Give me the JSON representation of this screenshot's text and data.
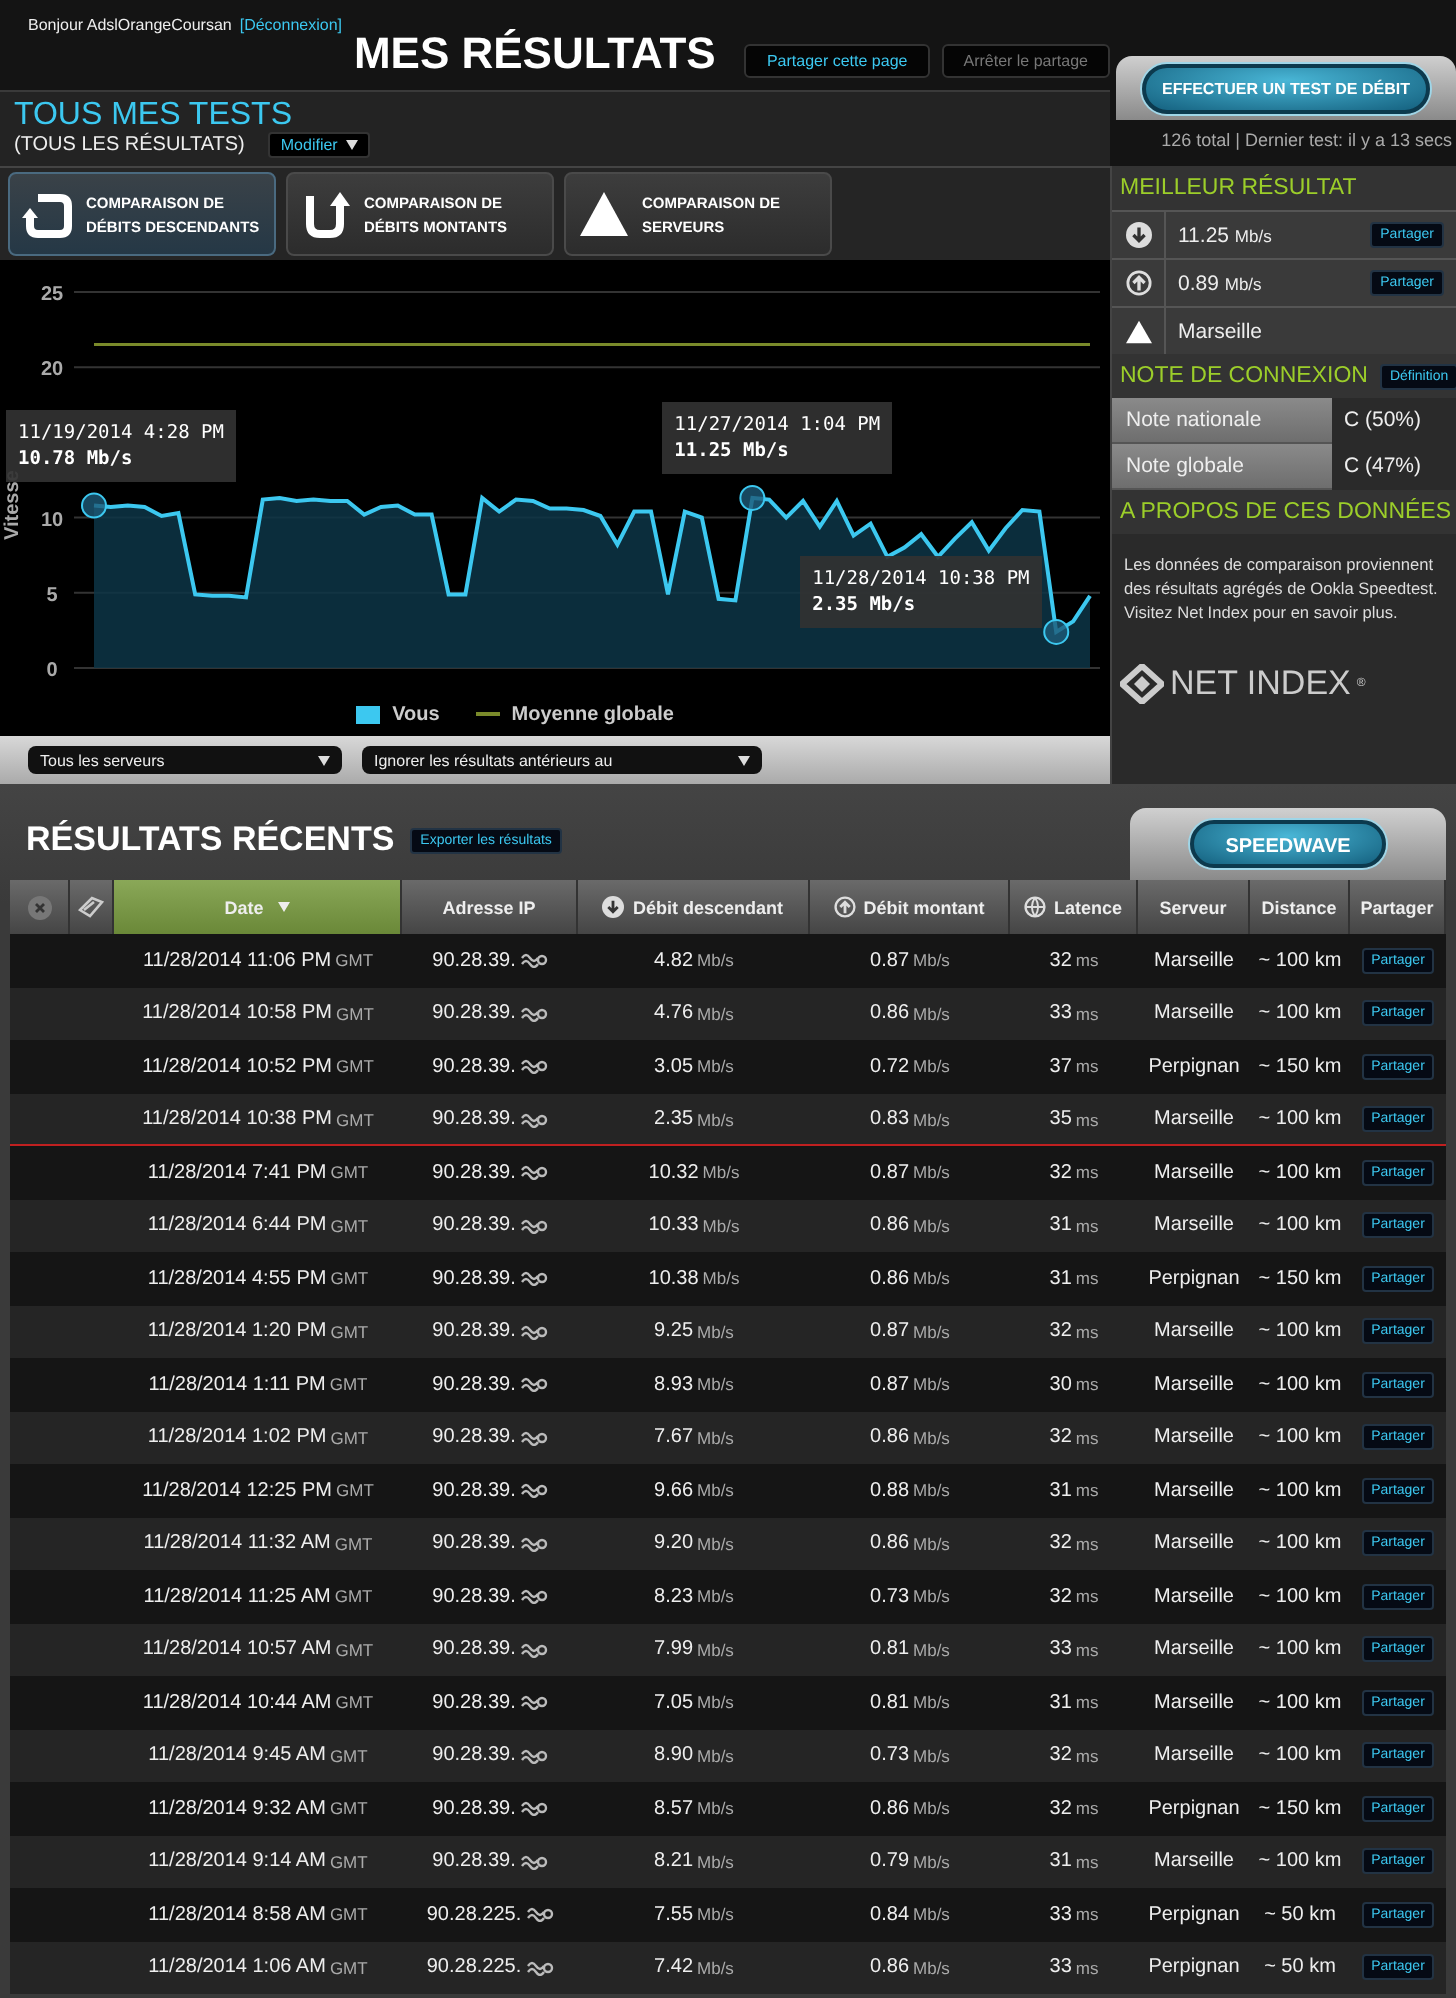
{
  "header": {
    "greeting": "Bonjour AdslOrangeCoursan",
    "logout": "[Déconnexion]",
    "title": "MES RÉSULTATS",
    "share_buttons": [
      {
        "label": "Partager cette page",
        "disabled": false
      },
      {
        "label": "Arrêter le partage",
        "disabled": true
      }
    ]
  },
  "test_button": "EFFECTUER UN TEST DE DÉBIT",
  "summary": "126 total | Dernier test: il y a 13 secs",
  "tests": {
    "title": "TOUS MES TESTS",
    "subtitle": "(TOUS LES RÉSULTATS)",
    "modify": "Modifier"
  },
  "compare_buttons": [
    {
      "kind": "download",
      "lines": [
        "COMPARAISON DE",
        "DÉBITS DESCENDANTS"
      ],
      "selected": true
    },
    {
      "kind": "upload",
      "lines": [
        "COMPARAISON DE",
        "DÉBITS MONTANTS"
      ],
      "selected": false
    },
    {
      "kind": "server",
      "lines": [
        "COMPARAISON DE",
        "SERVEURS"
      ],
      "selected": false
    }
  ],
  "chart_data": {
    "type": "line",
    "ylabel": "Vitesse",
    "ylim": [
      0,
      25
    ],
    "yticks": [
      0,
      5,
      10,
      20,
      25
    ],
    "grid": true,
    "legend": "bottom",
    "series": [
      {
        "name": "Vous",
        "color": "#3cc8f0",
        "values": [
          10.8,
          10.7,
          10.8,
          10.7,
          10.1,
          10.3,
          4.9,
          4.8,
          4.8,
          4.7,
          11.2,
          11.3,
          11.1,
          11.2,
          11.1,
          11.1,
          10.2,
          10.7,
          10.8,
          10.2,
          10.2,
          4.9,
          4.9,
          11.3,
          10.4,
          11.2,
          11.1,
          10.6,
          10.6,
          10.5,
          10.1,
          8.2,
          10.4,
          10.4,
          4.9,
          10.4,
          10.0,
          4.6,
          4.5,
          11.3,
          11.2,
          10.0,
          11.1,
          9.4,
          11.1,
          8.8,
          9.6,
          7.4,
          8.0,
          8.9,
          7.4,
          8.6,
          9.7,
          7.8,
          9.3,
          10.5,
          10.4,
          2.4,
          3.1,
          4.8
        ]
      },
      {
        "name": "Moyenne globale",
        "color": "#7a8a2a",
        "values": [
          21.5,
          21.5,
          21.5,
          21.5,
          21.5,
          21.5,
          21.5,
          21.5,
          21.5,
          21.5,
          21.5,
          21.5,
          21.5,
          21.5,
          21.5,
          21.5,
          21.5,
          21.5,
          21.5,
          21.5,
          21.5,
          21.5,
          21.5,
          21.5,
          21.5,
          21.5,
          21.5,
          21.5,
          21.5,
          21.5,
          21.5,
          21.5,
          21.5,
          21.5,
          21.5,
          21.5,
          21.5,
          21.5,
          21.5,
          21.5,
          21.5,
          21.5,
          21.5,
          21.5,
          21.5,
          21.5,
          21.5,
          21.5,
          21.5,
          21.5,
          21.5,
          21.5,
          21.5,
          21.5,
          21.5,
          21.5,
          21.5,
          21.5,
          21.5,
          21.5
        ]
      }
    ],
    "annotations": [
      "11/19/2014 4:28 PM\n10.78 Mb/s",
      "11/27/2014 1:04 PM\n11.25 Mb/s",
      "11/28/2014 10:38 PM\n2.35 Mb/s"
    ]
  },
  "filters": [
    "Tous les serveurs",
    "Ignorer les résultats antérieurs au"
  ],
  "best": {
    "title": "MEILLEUR RÉSULTAT",
    "items": [
      {
        "kind": "download",
        "value": "11.25",
        "unit": "Mb/s",
        "share": "Partager"
      },
      {
        "kind": "upload",
        "value": "0.89",
        "unit": "Mb/s",
        "share": "Partager"
      },
      {
        "kind": "server",
        "value": "Marseille"
      }
    ]
  },
  "grade": {
    "title": "NOTE DE CONNEXION",
    "definition": "Définition",
    "rows": [
      {
        "label": "Note nationale",
        "value": "C (50%)"
      },
      {
        "label": "Note globale",
        "value": "C (47%)"
      }
    ]
  },
  "about": {
    "title": "A PROPOS DE CES DONNÉES",
    "text": "Les données de comparaison proviennent des résultats agrégés de Ookla Speedtest. Visitez Net Index pour en savoir plus.",
    "logo": "NET INDEX",
    "logo_mark": "®"
  },
  "recent": {
    "title": "RÉSULTATS RÉCENTS",
    "export": "Exporter les résultats",
    "speedwave": "SPEEDWAVE"
  },
  "table": {
    "columns": [
      {
        "kind": "clear",
        "selected": false
      },
      {
        "kind": "tag",
        "selected": false
      },
      {
        "kind": "text",
        "label": "Date",
        "selected": true
      },
      {
        "kind": "text",
        "label": "Adresse IP",
        "selected": false
      },
      {
        "kind": "download",
        "label": "Débit descendant",
        "selected": false
      },
      {
        "kind": "upload",
        "label": "Débit montant",
        "selected": false
      },
      {
        "kind": "latency",
        "label": "Latence",
        "selected": false
      },
      {
        "kind": "text",
        "label": "Serveur",
        "selected": false
      },
      {
        "kind": "text",
        "label": "Distance",
        "selected": false
      },
      {
        "kind": "text",
        "label": "Partager",
        "selected": false
      }
    ],
    "rows": [
      {
        "date": "11/28/2014 11:06 PM",
        "tz": "GMT",
        "ip": "90.28.39.",
        "down": "4.82",
        "down_unit": "Mb/s",
        "up": "0.87",
        "up_unit": "Mb/s",
        "latency": "32",
        "latency_unit": "ms",
        "server": "Marseille",
        "distance": "~ 100 km",
        "share": "Partager",
        "highlighted": false
      },
      {
        "date": "11/28/2014 10:58 PM",
        "tz": "GMT",
        "ip": "90.28.39.",
        "down": "4.76",
        "down_unit": "Mb/s",
        "up": "0.86",
        "up_unit": "Mb/s",
        "latency": "33",
        "latency_unit": "ms",
        "server": "Marseille",
        "distance": "~ 100 km",
        "share": "Partager",
        "highlighted": false
      },
      {
        "date": "11/28/2014 10:52 PM",
        "tz": "GMT",
        "ip": "90.28.39.",
        "down": "3.05",
        "down_unit": "Mb/s",
        "up": "0.72",
        "up_unit": "Mb/s",
        "latency": "37",
        "latency_unit": "ms",
        "server": "Perpignan",
        "distance": "~ 150 km",
        "share": "Partager",
        "highlighted": false
      },
      {
        "date": "11/28/2014 10:38 PM",
        "tz": "GMT",
        "ip": "90.28.39.",
        "down": "2.35",
        "down_unit": "Mb/s",
        "up": "0.83",
        "up_unit": "Mb/s",
        "latency": "35",
        "latency_unit": "ms",
        "server": "Marseille",
        "distance": "~ 100 km",
        "share": "Partager",
        "highlighted": true
      },
      {
        "date": "11/28/2014 7:41 PM",
        "tz": "GMT",
        "ip": "90.28.39.",
        "down": "10.32",
        "down_unit": "Mb/s",
        "up": "0.87",
        "up_unit": "Mb/s",
        "latency": "32",
        "latency_unit": "ms",
        "server": "Marseille",
        "distance": "~ 100 km",
        "share": "Partager",
        "highlighted": false
      },
      {
        "date": "11/28/2014 6:44 PM",
        "tz": "GMT",
        "ip": "90.28.39.",
        "down": "10.33",
        "down_unit": "Mb/s",
        "up": "0.86",
        "up_unit": "Mb/s",
        "latency": "31",
        "latency_unit": "ms",
        "server": "Marseille",
        "distance": "~ 100 km",
        "share": "Partager",
        "highlighted": false
      },
      {
        "date": "11/28/2014 4:55 PM",
        "tz": "GMT",
        "ip": "90.28.39.",
        "down": "10.38",
        "down_unit": "Mb/s",
        "up": "0.86",
        "up_unit": "Mb/s",
        "latency": "31",
        "latency_unit": "ms",
        "server": "Perpignan",
        "distance": "~ 150 km",
        "share": "Partager",
        "highlighted": false
      },
      {
        "date": "11/28/2014 1:20 PM",
        "tz": "GMT",
        "ip": "90.28.39.",
        "down": "9.25",
        "down_unit": "Mb/s",
        "up": "0.87",
        "up_unit": "Mb/s",
        "latency": "32",
        "latency_unit": "ms",
        "server": "Marseille",
        "distance": "~ 100 km",
        "share": "Partager",
        "highlighted": false
      },
      {
        "date": "11/28/2014 1:11 PM",
        "tz": "GMT",
        "ip": "90.28.39.",
        "down": "8.93",
        "down_unit": "Mb/s",
        "up": "0.87",
        "up_unit": "Mb/s",
        "latency": "30",
        "latency_unit": "ms",
        "server": "Marseille",
        "distance": "~ 100 km",
        "share": "Partager",
        "highlighted": false
      },
      {
        "date": "11/28/2014 1:02 PM",
        "tz": "GMT",
        "ip": "90.28.39.",
        "down": "7.67",
        "down_unit": "Mb/s",
        "up": "0.86",
        "up_unit": "Mb/s",
        "latency": "32",
        "latency_unit": "ms",
        "server": "Marseille",
        "distance": "~ 100 km",
        "share": "Partager",
        "highlighted": false
      },
      {
        "date": "11/28/2014 12:25 PM",
        "tz": "GMT",
        "ip": "90.28.39.",
        "down": "9.66",
        "down_unit": "Mb/s",
        "up": "0.88",
        "up_unit": "Mb/s",
        "latency": "31",
        "latency_unit": "ms",
        "server": "Marseille",
        "distance": "~ 100 km",
        "share": "Partager",
        "highlighted": false
      },
      {
        "date": "11/28/2014 11:32 AM",
        "tz": "GMT",
        "ip": "90.28.39.",
        "down": "9.20",
        "down_unit": "Mb/s",
        "up": "0.86",
        "up_unit": "Mb/s",
        "latency": "32",
        "latency_unit": "ms",
        "server": "Marseille",
        "distance": "~ 100 km",
        "share": "Partager",
        "highlighted": false
      },
      {
        "date": "11/28/2014 11:25 AM",
        "tz": "GMT",
        "ip": "90.28.39.",
        "down": "8.23",
        "down_unit": "Mb/s",
        "up": "0.73",
        "up_unit": "Mb/s",
        "latency": "32",
        "latency_unit": "ms",
        "server": "Marseille",
        "distance": "~ 100 km",
        "share": "Partager",
        "highlighted": false
      },
      {
        "date": "11/28/2014 10:57 AM",
        "tz": "GMT",
        "ip": "90.28.39.",
        "down": "7.99",
        "down_unit": "Mb/s",
        "up": "0.81",
        "up_unit": "Mb/s",
        "latency": "33",
        "latency_unit": "ms",
        "server": "Marseille",
        "distance": "~ 100 km",
        "share": "Partager",
        "highlighted": false
      },
      {
        "date": "11/28/2014 10:44 AM",
        "tz": "GMT",
        "ip": "90.28.39.",
        "down": "7.05",
        "down_unit": "Mb/s",
        "up": "0.81",
        "up_unit": "Mb/s",
        "latency": "31",
        "latency_unit": "ms",
        "server": "Marseille",
        "distance": "~ 100 km",
        "share": "Partager",
        "highlighted": false
      },
      {
        "date": "11/28/2014 9:45 AM",
        "tz": "GMT",
        "ip": "90.28.39.",
        "down": "8.90",
        "down_unit": "Mb/s",
        "up": "0.73",
        "up_unit": "Mb/s",
        "latency": "32",
        "latency_unit": "ms",
        "server": "Marseille",
        "distance": "~ 100 km",
        "share": "Partager",
        "highlighted": false
      },
      {
        "date": "11/28/2014 9:32 AM",
        "tz": "GMT",
        "ip": "90.28.39.",
        "down": "8.57",
        "down_unit": "Mb/s",
        "up": "0.86",
        "up_unit": "Mb/s",
        "latency": "32",
        "latency_unit": "ms",
        "server": "Perpignan",
        "distance": "~ 150 km",
        "share": "Partager",
        "highlighted": false
      },
      {
        "date": "11/28/2014 9:14 AM",
        "tz": "GMT",
        "ip": "90.28.39.",
        "down": "8.21",
        "down_unit": "Mb/s",
        "up": "0.79",
        "up_unit": "Mb/s",
        "latency": "31",
        "latency_unit": "ms",
        "server": "Marseille",
        "distance": "~ 100 km",
        "share": "Partager",
        "highlighted": false
      },
      {
        "date": "11/28/2014 8:58 AM",
        "tz": "GMT",
        "ip": "90.28.225.",
        "down": "7.55",
        "down_unit": "Mb/s",
        "up": "0.84",
        "up_unit": "Mb/s",
        "latency": "33",
        "latency_unit": "ms",
        "server": "Perpignan",
        "distance": "~ 50 km",
        "share": "Partager",
        "highlighted": false
      },
      {
        "date": "11/28/2014 1:06 AM",
        "tz": "GMT",
        "ip": "90.28.225.",
        "down": "7.42",
        "down_unit": "Mb/s",
        "up": "0.86",
        "up_unit": "Mb/s",
        "latency": "33",
        "latency_unit": "ms",
        "server": "Perpignan",
        "distance": "~ 50 km",
        "share": "Partager",
        "highlighted": false
      }
    ]
  }
}
